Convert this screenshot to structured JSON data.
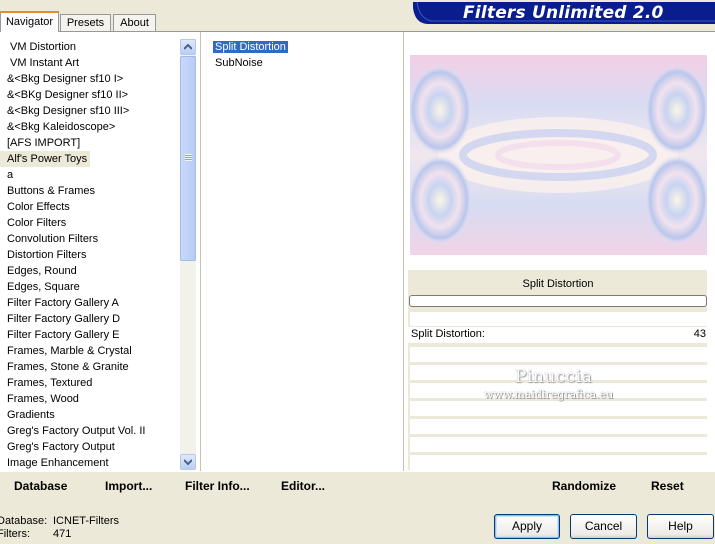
{
  "app": {
    "title": "Filters Unlimited 2.0"
  },
  "tabs": [
    {
      "label": "Navigator",
      "active": true
    },
    {
      "label": "Presets",
      "active": false
    },
    {
      "label": "About",
      "active": false
    }
  ],
  "categories": [
    "VM Distortion",
    "VM Instant Art",
    "&<Bkg Designer sf10 I>",
    "&<BKg Designer sf10 II>",
    "&<Bkg Designer sf10 III>",
    "&<Bkg Kaleidoscope>",
    "[AFS IMPORT]",
    "Alf's Power Toys",
    "a",
    "Buttons & Frames",
    "Color Effects",
    "Color Filters",
    "Convolution Filters",
    "Distortion Filters",
    "Edges, Round",
    "Edges, Square",
    "Filter Factory Gallery A",
    "Filter Factory Gallery D",
    "Filter Factory Gallery E",
    "Frames, Marble & Crystal",
    "Frames, Stone & Granite",
    "Frames, Textured",
    "Frames, Wood",
    "Gradients",
    "Greg's Factory Output Vol. II",
    "Greg's Factory Output",
    "Image Enhancement"
  ],
  "selected_category": "Alf's Power Toys",
  "filters": [
    "Split Distortion",
    "SubNoise"
  ],
  "selected_filter": "Split Distortion",
  "preview": {
    "filter_name": "Split Distortion"
  },
  "parameters": [
    {
      "label": "Split Distortion:",
      "value": "43"
    }
  ],
  "watermark": {
    "name": "Pinuccia",
    "url": "www.maidiregrafica.eu"
  },
  "toolbar": {
    "database": "Database",
    "import": "Import...",
    "filter_info": "Filter Info...",
    "editor": "Editor...",
    "randomize": "Randomize",
    "reset": "Reset"
  },
  "status": {
    "database_label": "Database:",
    "database_value": "ICNET-Filters",
    "filters_label": "Filters:",
    "filters_value": "471"
  },
  "buttons": {
    "apply": "Apply",
    "cancel": "Cancel",
    "help": "Help"
  },
  "colors": {
    "banner": "#0a1d8c",
    "selection": "#316ac5",
    "tab_highlight": "#e68b2c"
  }
}
